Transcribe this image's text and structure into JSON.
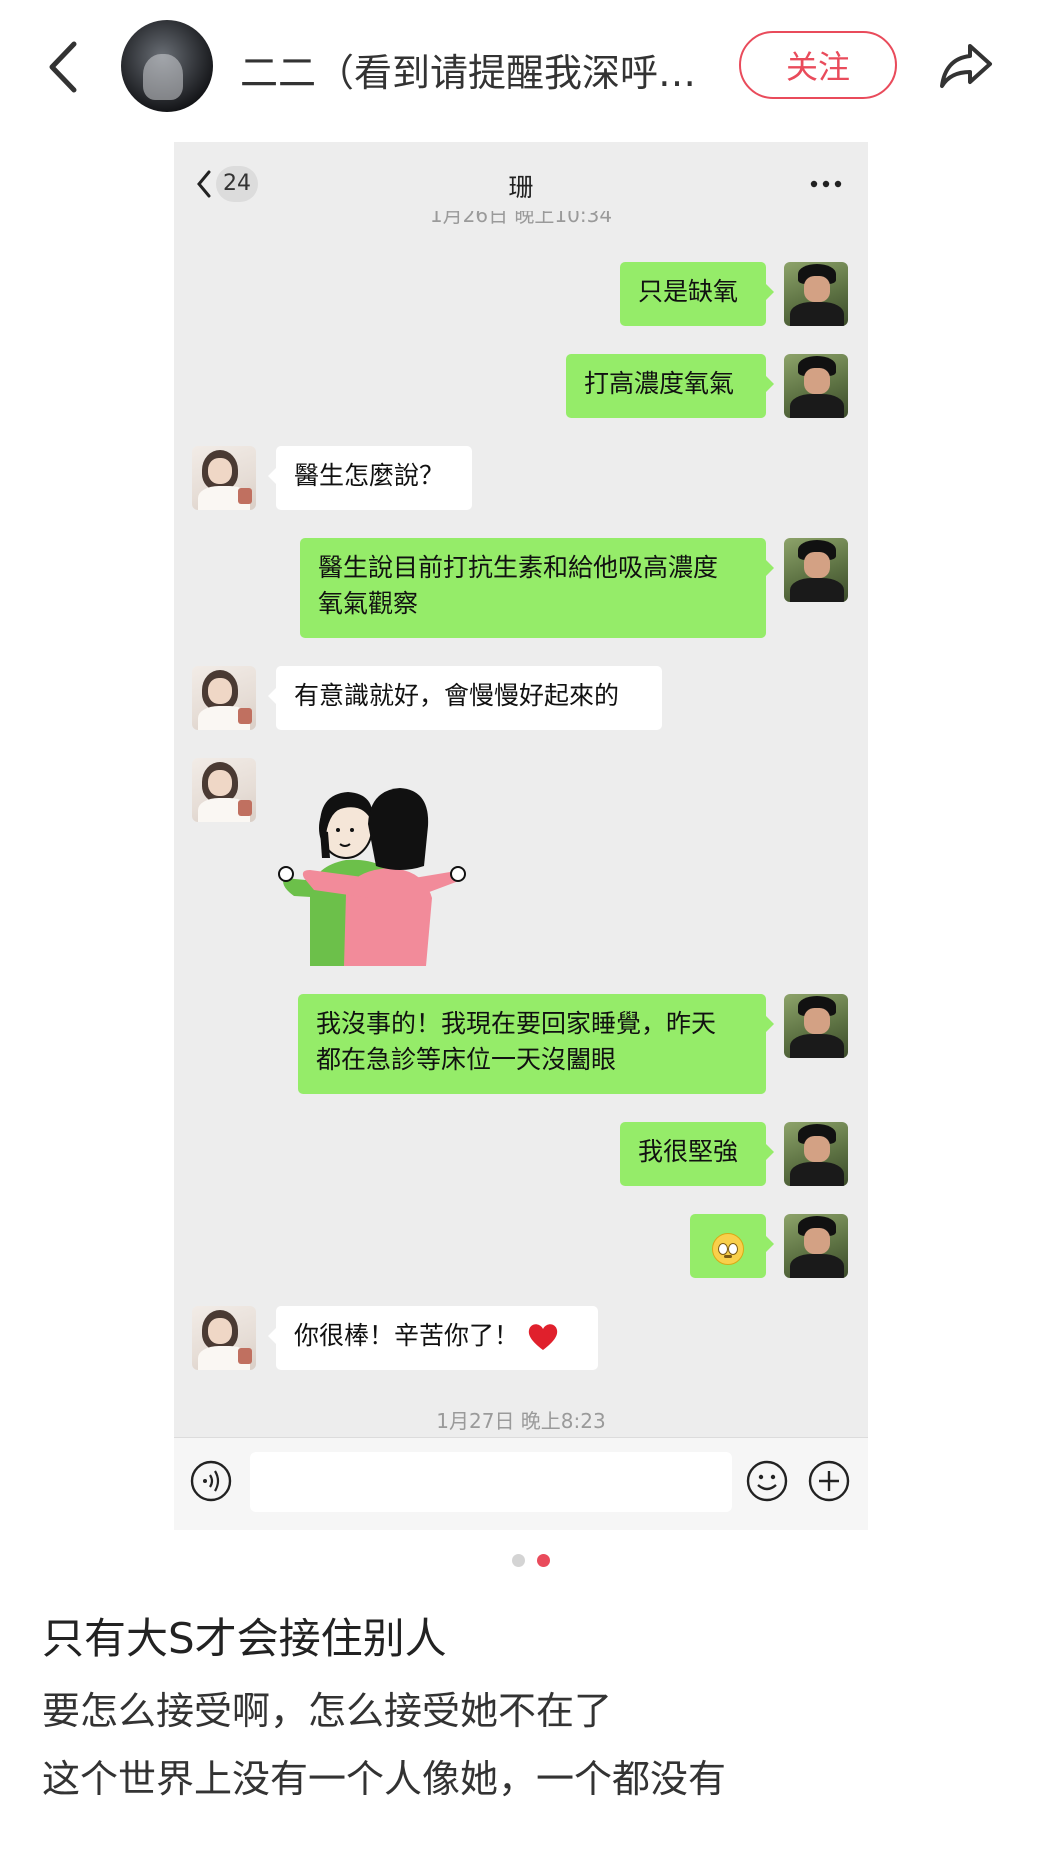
{
  "header": {
    "author": "二二（看到请提醒我深呼…",
    "follow_label": "关注"
  },
  "chat": {
    "unread_count": "24",
    "contact_name": "珊",
    "top_timestamp": "1月26日 晚上10:34",
    "messages": [
      {
        "from": "me",
        "type": "text",
        "text": "只是缺氧"
      },
      {
        "from": "me",
        "type": "text",
        "text": "打高濃度氧氣"
      },
      {
        "from": "her",
        "type": "text",
        "text": "醫生怎麼說？"
      },
      {
        "from": "me",
        "type": "text",
        "line1": "醫生說目前打抗生素和給他吸高濃度",
        "line2": "氧氣觀察"
      },
      {
        "from": "her",
        "type": "text",
        "text": "有意識就好，會慢慢好起來的"
      },
      {
        "from": "her",
        "type": "sticker",
        "sticker": "hug-sticker"
      },
      {
        "from": "me",
        "type": "text",
        "line1": "我沒事的！我現在要回家睡覺，昨天",
        "line2": "都在急診等床位一天沒闔眼"
      },
      {
        "from": "me",
        "type": "text",
        "text": "我很堅強"
      },
      {
        "from": "me",
        "type": "emoji",
        "emoji": "pleading-face"
      },
      {
        "from": "her",
        "type": "text",
        "text": "你很棒！辛苦你了！",
        "trailing_icon": "red-heart"
      }
    ],
    "bottom_timestamp": "1月27日 晚上8:23"
  },
  "pager": {
    "total": 2,
    "current": 2
  },
  "post": {
    "title": "只有大S才会接住别人",
    "line1": "要怎么接受啊，怎么接受她不在了",
    "line2": "这个世界上没有一个人像她，一个都没有"
  },
  "colors": {
    "accent": "#e94b5b",
    "bubble_green": "#95ec69",
    "chat_bg": "#ededed"
  }
}
